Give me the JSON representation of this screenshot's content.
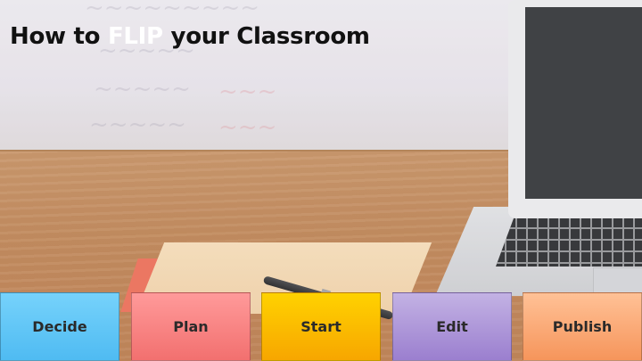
{
  "title": {
    "prefix": "How to ",
    "highlight": "FLIP",
    "suffix": " your Classroom"
  },
  "steps": [
    {
      "label": "Decide"
    },
    {
      "label": "Plan"
    },
    {
      "label": "Start"
    },
    {
      "label": "Edit"
    },
    {
      "label": "Publish"
    }
  ],
  "colors": {
    "decide": "#5ec5f6",
    "plan": "#f47c7c",
    "start": "#fbc200",
    "edit": "#a88fd6",
    "publish": "#f9a56f",
    "title_highlight": "#ffffff"
  }
}
